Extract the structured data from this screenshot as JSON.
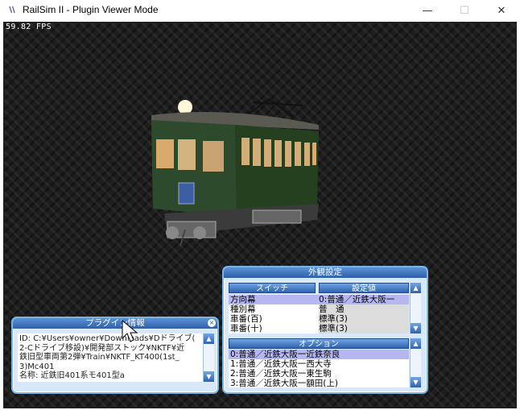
{
  "window": {
    "icon_text": "\\\\",
    "title": "RailSim II - Plugin Viewer Mode",
    "minimize_glyph": "—",
    "maximize_glyph": "☐",
    "close_glyph": "✕"
  },
  "viewport": {
    "fps": "59.82 FPS"
  },
  "appearance_panel": {
    "title": "外観設定",
    "switch_header": "スイッチ",
    "value_header": "設定値",
    "switch_rows": [
      {
        "name": "方向幕",
        "value": "0:普通／近鉄大阪一"
      },
      {
        "name": "種別幕",
        "value": "普　通"
      },
      {
        "name": "車番(百)",
        "value": "標準(3)"
      },
      {
        "name": "車番(十)",
        "value": "標準(3)"
      }
    ],
    "option_header": "オプション",
    "options": [
      "0:普通／近鉄大阪一近鉄奈良",
      "1:普通／近鉄大阪一西大寺",
      "2:普通／近鉄大阪一東生駒",
      "3:普通／近鉄大阪一額田(上)"
    ]
  },
  "plugin_panel": {
    "title": "プラグイン情報",
    "close_glyph": "×",
    "lines": [
      "ID: C:¥Users¥owner¥Downloads¥Dドライブ(",
      "2-Cドライブ移設)¥開発部ストック¥NKTF¥近",
      "鉄旧型車両第2弾¥Train¥NKTF_KT400(1st_",
      "3)Mc401",
      "名称: 近鉄旧401系モ401型a"
    ]
  },
  "scroll": {
    "up": "▲",
    "down": "▼"
  },
  "colors": {
    "train_body": "#2e4a2c",
    "panel_border": "#7ab3e6",
    "panel_title": "#2c5fa8",
    "selected_row": "#b6b6f0"
  }
}
